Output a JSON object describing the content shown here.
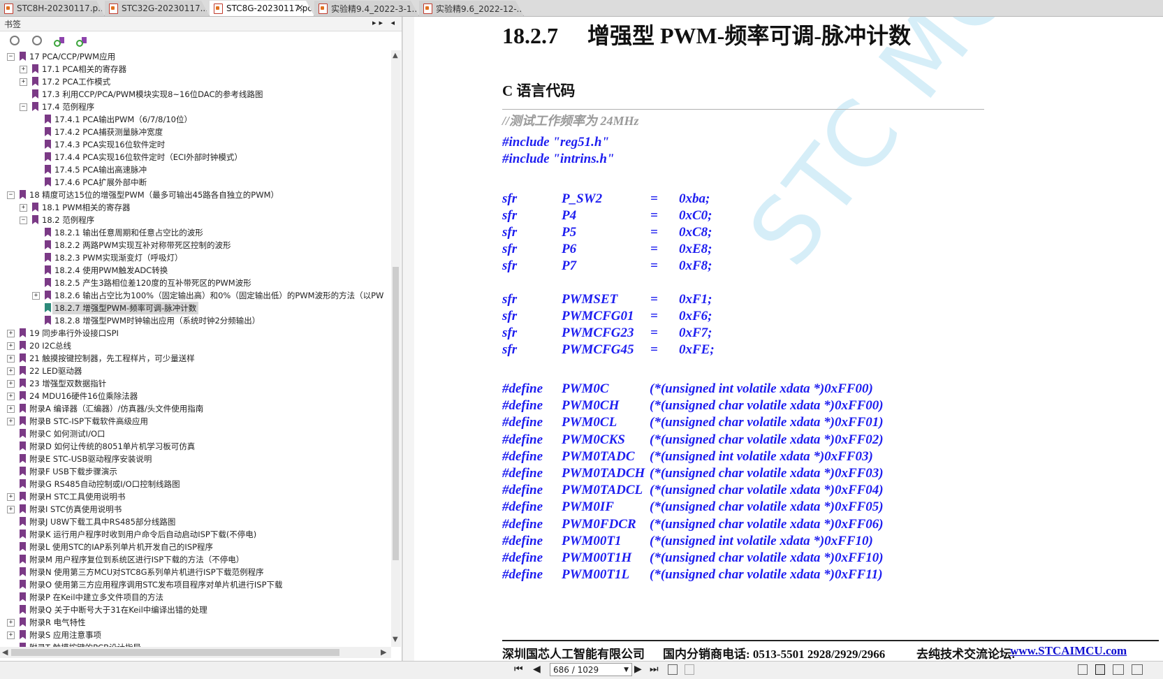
{
  "tabs": [
    {
      "label": "STC8H-20230117.p...",
      "active": false
    },
    {
      "label": "STC32G-20230117....",
      "active": false
    },
    {
      "label": "STC8G-20230117.pdf...",
      "active": true,
      "close": "×"
    },
    {
      "label": "实验精9.4_2022-3-1...",
      "active": false
    },
    {
      "label": "实验精9.6_2022-12-...",
      "active": false
    }
  ],
  "panel": {
    "title": "书签",
    "controls": "▸▸ ◂",
    "tools": [
      "expand-all-icon",
      "collapse-all-icon",
      "add-bookmark-icon",
      "find-bookmark-icon"
    ]
  },
  "tree": [
    {
      "label": "17 PCA/CCP/PWM应用",
      "level": 0,
      "exp": "−"
    },
    {
      "label": "17.1 PCA相关的寄存器",
      "level": 1,
      "exp": "+"
    },
    {
      "label": "17.2 PCA工作模式",
      "level": 1,
      "exp": "+"
    },
    {
      "label": "17.3 利用CCP/PCA/PWM模块实现8~16位DAC的参考线路图",
      "level": 1,
      "exp": ""
    },
    {
      "label": "17.4 范例程序",
      "level": 1,
      "exp": "−"
    },
    {
      "label": "17.4.1 PCA输出PWM（6/7/8/10位）",
      "level": 2,
      "exp": ""
    },
    {
      "label": "17.4.2 PCA捕获测量脉冲宽度",
      "level": 2,
      "exp": ""
    },
    {
      "label": "17.4.3 PCA实现16位软件定时",
      "level": 2,
      "exp": ""
    },
    {
      "label": "17.4.4 PCA实现16位软件定时（ECI外部时钟模式）",
      "level": 2,
      "exp": ""
    },
    {
      "label": "17.4.5 PCA输出高速脉冲",
      "level": 2,
      "exp": ""
    },
    {
      "label": "17.4.6 PCA扩展外部中断",
      "level": 2,
      "exp": ""
    },
    {
      "label": "18 精度可达15位的增强型PWM（最多可输出45路各自独立的PWM）",
      "level": 0,
      "exp": "−"
    },
    {
      "label": "18.1 PWM相关的寄存器",
      "level": 1,
      "exp": "+"
    },
    {
      "label": "18.2 范例程序",
      "level": 1,
      "exp": "−"
    },
    {
      "label": "18.2.1 输出任意周期和任意占空比的波形",
      "level": 2,
      "exp": ""
    },
    {
      "label": "18.2.2 两路PWM实现互补对称带死区控制的波形",
      "level": 2,
      "exp": ""
    },
    {
      "label": "18.2.3 PWM实现渐变灯（呼吸灯）",
      "level": 2,
      "exp": ""
    },
    {
      "label": "18.2.4 使用PWM触发ADC转换",
      "level": 2,
      "exp": ""
    },
    {
      "label": "18.2.5 产生3路相位差120度的互补带死区的PWM波形",
      "level": 2,
      "exp": ""
    },
    {
      "label": "18.2.6 输出占空比为100%（固定输出高）和0%（固定输出低）的PWM波形的方法（以PW",
      "level": 2,
      "exp": "+"
    },
    {
      "label": "18.2.7 增强型PWM-频率可调-脉冲计数",
      "level": 2,
      "exp": "",
      "selected": true
    },
    {
      "label": "18.2.8 增强型PWM时钟输出应用（系统时钟2分频输出）",
      "level": 2,
      "exp": ""
    },
    {
      "label": "19 同步串行外设接口SPI",
      "level": 0,
      "exp": "+"
    },
    {
      "label": "20 I2C总线",
      "level": 0,
      "exp": "+"
    },
    {
      "label": "21 触摸按键控制器，先工程样片，可少量送样",
      "level": 0,
      "exp": "+"
    },
    {
      "label": "22 LED驱动器",
      "level": 0,
      "exp": "+"
    },
    {
      "label": "23 增强型双数据指针",
      "level": 0,
      "exp": "+"
    },
    {
      "label": "24 MDU16硬件16位乘除法器",
      "level": 0,
      "exp": "+"
    },
    {
      "label": "附录A 编译器（汇编器）/仿真器/头文件使用指南",
      "level": 0,
      "exp": "+"
    },
    {
      "label": "附录B STC-ISP下载软件高级应用",
      "level": 0,
      "exp": "+"
    },
    {
      "label": "附录C 如何测试I/O口",
      "level": 0,
      "exp": ""
    },
    {
      "label": "附录D 如何让传统的8051单片机学习板可仿真",
      "level": 0,
      "exp": ""
    },
    {
      "label": "附录E STC-USB驱动程序安装说明",
      "level": 0,
      "exp": ""
    },
    {
      "label": "附录F USB下载步骤演示",
      "level": 0,
      "exp": ""
    },
    {
      "label": "附录G RS485自动控制或I/O口控制线路图",
      "level": 0,
      "exp": ""
    },
    {
      "label": "附录H STC工具使用说明书",
      "level": 0,
      "exp": "+"
    },
    {
      "label": "附录I STC仿真使用说明书",
      "level": 0,
      "exp": "+"
    },
    {
      "label": "附录J U8W下载工具中RS485部分线路图",
      "level": 0,
      "exp": ""
    },
    {
      "label": "附录K 运行用户程序时收到用户命令后自动启动ISP下载(不停电)",
      "level": 0,
      "exp": ""
    },
    {
      "label": "附录L 使用STC的IAP系列单片机开发自己的ISP程序",
      "level": 0,
      "exp": ""
    },
    {
      "label": "附录M 用户程序复位到系统区进行ISP下载的方法（不停电）",
      "level": 0,
      "exp": ""
    },
    {
      "label": "附录N 使用第三方MCU对STC8G系列单片机进行ISP下载范例程序",
      "level": 0,
      "exp": ""
    },
    {
      "label": "附录O 使用第三方应用程序调用STC发布项目程序对单片机进行ISP下载",
      "level": 0,
      "exp": ""
    },
    {
      "label": "附录P 在Keil中建立多文件项目的方法",
      "level": 0,
      "exp": ""
    },
    {
      "label": "附录Q 关于中断号大于31在Keil中编译出错的处理",
      "level": 0,
      "exp": ""
    },
    {
      "label": "附录R 电气特性",
      "level": 0,
      "exp": "+"
    },
    {
      "label": "附录S 应用注意事项",
      "level": 0,
      "exp": "+"
    },
    {
      "label": "附录T 触摸按键的PCB设计指导",
      "level": 0,
      "exp": ""
    }
  ],
  "doc": {
    "heading_num": "18.2.7",
    "heading_text": "增强型 PWM-频率可调-脉冲计数",
    "subheading": "C 语言代码",
    "comment": "//测试工作频率为 24MHz",
    "watermark": "STC MCU",
    "includes": [
      "#include \"reg51.h\"",
      "#include \"intrins.h\""
    ],
    "sfr1": [
      {
        "kw": "sfr",
        "name": "P_SW2",
        "eq": "=",
        "val": "0xba;"
      },
      {
        "kw": "sfr",
        "name": "P4",
        "eq": "=",
        "val": "0xC0;"
      },
      {
        "kw": "sfr",
        "name": "P5",
        "eq": "=",
        "val": "0xC8;"
      },
      {
        "kw": "sfr",
        "name": "P6",
        "eq": "=",
        "val": "0xE8;"
      },
      {
        "kw": "sfr",
        "name": "P7",
        "eq": "=",
        "val": "0xF8;"
      }
    ],
    "sfr2": [
      {
        "kw": "sfr",
        "name": "PWMSET",
        "eq": "=",
        "val": "0xF1;"
      },
      {
        "kw": "sfr",
        "name": "PWMCFG01",
        "eq": "=",
        "val": "0xF6;"
      },
      {
        "kw": "sfr",
        "name": "PWMCFG23",
        "eq": "=",
        "val": "0xF7;"
      },
      {
        "kw": "sfr",
        "name": "PWMCFG45",
        "eq": "=",
        "val": "0xFE;"
      }
    ],
    "defines": [
      {
        "kw": "#define",
        "name": "PWM0C",
        "val": "(*(unsigned int volatile xdata *)0xFF00)"
      },
      {
        "kw": "#define",
        "name": "PWM0CH",
        "val": "(*(unsigned char volatile xdata *)0xFF00)"
      },
      {
        "kw": "#define",
        "name": "PWM0CL",
        "val": "(*(unsigned char volatile xdata *)0xFF01)"
      },
      {
        "kw": "#define",
        "name": "PWM0CKS",
        "val": "(*(unsigned char volatile xdata *)0xFF02)"
      },
      {
        "kw": "#define",
        "name": "PWM0TADC",
        "val": "(*(unsigned int volatile xdata *)0xFF03)"
      },
      {
        "kw": "#define",
        "name": "PWM0TADCH",
        "val": "(*(unsigned char volatile xdata *)0xFF03)"
      },
      {
        "kw": "#define",
        "name": "PWM0TADCL",
        "val": "(*(unsigned char volatile xdata *)0xFF04)"
      },
      {
        "kw": "#define",
        "name": "PWM0IF",
        "val": "(*(unsigned char volatile xdata *)0xFF05)"
      },
      {
        "kw": "#define",
        "name": "PWM0FDCR",
        "val": "(*(unsigned char volatile xdata *)0xFF06)"
      },
      {
        "kw": "#define",
        "name": "PWM00T1",
        "val": "(*(unsigned int volatile xdata *)0xFF10)"
      },
      {
        "kw": "#define",
        "name": "PWM00T1H",
        "val": "(*(unsigned char volatile xdata *)0xFF10)"
      },
      {
        "kw": "#define",
        "name": "PWM00T1L",
        "val": "(*(unsigned char volatile xdata *)0xFF11)"
      }
    ],
    "footer": {
      "company": "深圳国芯人工智能有限公司",
      "phone": "国内分销商电话: 0513-5501 2928/2929/2966",
      "forum_label": "去纯技术交流论坛:",
      "forum_link": "www.STCAIMCU.com"
    }
  },
  "nav": {
    "first": "⏮",
    "prev": "◀",
    "page": "686 / 1029",
    "page_dropdown": "▼",
    "next": "▶",
    "last": "⏭",
    "extra_icons": [
      "copy-page-icon",
      "paste-page-icon"
    ],
    "view_icons": [
      "single-page-icon",
      "continuous-page-icon",
      "two-page-icon",
      "two-page-continuous-icon"
    ]
  }
}
